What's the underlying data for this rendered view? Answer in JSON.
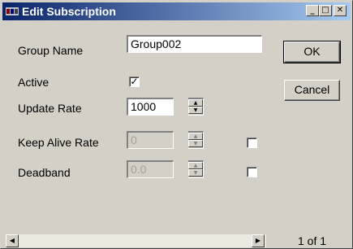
{
  "window": {
    "title": "Edit Subscription"
  },
  "titlebar": {
    "minimize": "_",
    "maximize": "□",
    "close": "✕"
  },
  "form": {
    "group_name": {
      "label": "Group Name",
      "value": "Group002"
    },
    "active": {
      "label": "Active",
      "checked": true
    },
    "update_rate": {
      "label": "Update Rate",
      "value": "1000"
    },
    "keep_alive_rate": {
      "label": "Keep Alive Rate",
      "value": "0",
      "enabled": false,
      "checked": false
    },
    "deadband": {
      "label": "Deadband",
      "value": "0.0",
      "enabled": false,
      "checked": false
    }
  },
  "buttons": {
    "ok": "OK",
    "cancel": "Cancel"
  },
  "footer": {
    "page_indicator": "1 of 1"
  },
  "icons": {
    "check": "✓",
    "up_arrow": "▲",
    "down_arrow": "▼",
    "left_arrow": "◀",
    "right_arrow": "▶"
  }
}
